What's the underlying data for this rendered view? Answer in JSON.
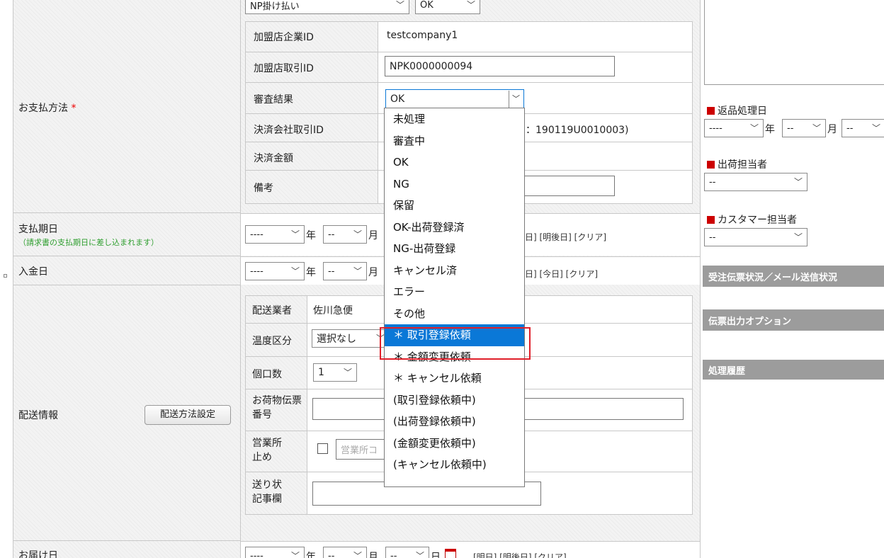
{
  "payment": {
    "label": "お支払方法",
    "required_mark": "*",
    "method_select": "NP掛け払い",
    "status_select": "OK",
    "rows": {
      "merchant_company_id": {
        "label": "加盟店企業ID",
        "value": "testcompany1"
      },
      "merchant_transaction_id": {
        "label": "加盟店取引ID",
        "value": "NPK0000000094"
      },
      "review_result": {
        "label": "審査結果",
        "value": "OK"
      },
      "payment_company_txn_id": {
        "label": "決済会社取引ID",
        "value": "：190119U0010003)"
      },
      "settlement_amount": {
        "label": "決済金額"
      },
      "remarks": {
        "label": "備考"
      }
    }
  },
  "due_date": {
    "label": "支払期日",
    "note": "（請求書の支払期日に差し込まれます）",
    "year": "----",
    "year_unit": "年",
    "month": "--",
    "month_unit": "月",
    "links_tail": "日] [明後日] [クリア]"
  },
  "deposit_date": {
    "label": "入金日",
    "year": "----",
    "year_unit": "年",
    "month": "--",
    "month_unit": "月",
    "links_tail": "日] [今日] [クリア]"
  },
  "shipping": {
    "label": "配送情報",
    "method_button": "配送方法設定",
    "carrier_label": "配送業者",
    "carrier_value": "佐川急便",
    "temp_label": "温度区分",
    "temp_value": "選択なし",
    "pieces_label": "個口数",
    "pieces_value": "1",
    "tracking_label": "お荷物伝票番号",
    "office_hold_label": "営業所止め",
    "office_placeholder": "営業所コ",
    "slip_note_label": "送り状記事欄"
  },
  "delivery_date": {
    "label": "お届け日",
    "year": "----",
    "year_unit": "年",
    "month": "--",
    "month_unit": "月",
    "day": "--",
    "day_unit": "日",
    "links": "[明日] [明後日] [クリア]"
  },
  "sidebar": {
    "return_date_label": "返品処理日",
    "return_year": "----",
    "return_year_unit": "年",
    "return_month": "--",
    "return_month_unit": "月",
    "return_day": "--",
    "shipping_staff_label": "出荷担当者",
    "shipping_staff_value": "--",
    "customer_staff_label": "カスタマー担当者",
    "customer_staff_value": "--",
    "bar_order_status": "受注伝票状況／メール送信状況",
    "bar_slip_output": "伝票出力オプション",
    "bar_history": "処理履歴"
  },
  "dropdown": {
    "options": [
      "未処理",
      "審査中",
      "OK",
      "NG",
      "保留",
      "OK-出荷登録済",
      "NG-出荷登録",
      "キャンセル済",
      "エラー",
      "その他",
      "＊ 取引登録依頼",
      "＊ 金額変更依頼",
      "＊ キャンセル依頼",
      "(取引登録依頼中)",
      "(出荷登録依頼中)",
      "(金額変更依頼中)",
      "(キャンセル依頼中)"
    ],
    "highlighted": "＊ 取引登録依頼"
  },
  "colors": {
    "accent_red": "#e00000",
    "highlight_blue": "#0a78d7",
    "note_green": "#2e9e2e"
  }
}
